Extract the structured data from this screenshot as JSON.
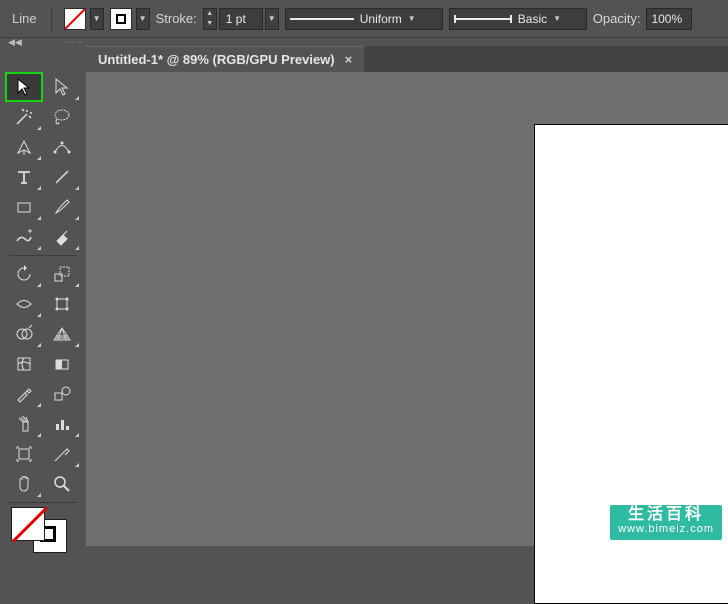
{
  "topbar": {
    "tool_name": "Line",
    "stroke_label": "Stroke:",
    "stroke_weight": "1 pt",
    "profile_uniform": "Uniform",
    "profile_basic": "Basic",
    "opacity_label": "Opacity:",
    "opacity_value": "100%"
  },
  "tab": {
    "title": "Untitled-1* @ 89% (RGB/GPU Preview)",
    "close": "×"
  },
  "tools": {
    "rows": [
      [
        "selection",
        "direct-selection"
      ],
      [
        "magic-wand",
        "lasso"
      ],
      [
        "pen",
        "curvature"
      ],
      [
        "type",
        "line-segment"
      ],
      [
        "rectangle",
        "paintbrush"
      ],
      [
        "shaper",
        "eraser"
      ],
      [
        "rotate",
        "scale"
      ],
      [
        "width",
        "free-transform"
      ],
      [
        "shape-builder",
        "perspective-grid"
      ],
      [
        "mesh",
        "gradient"
      ],
      [
        "eyedropper",
        "blend"
      ],
      [
        "symbol-sprayer",
        "column-graph"
      ],
      [
        "artboard",
        "slice"
      ],
      [
        "hand",
        "zoom"
      ]
    ]
  },
  "watermark": {
    "line1": "生活百科",
    "line2": "www.bimeiz.com"
  }
}
